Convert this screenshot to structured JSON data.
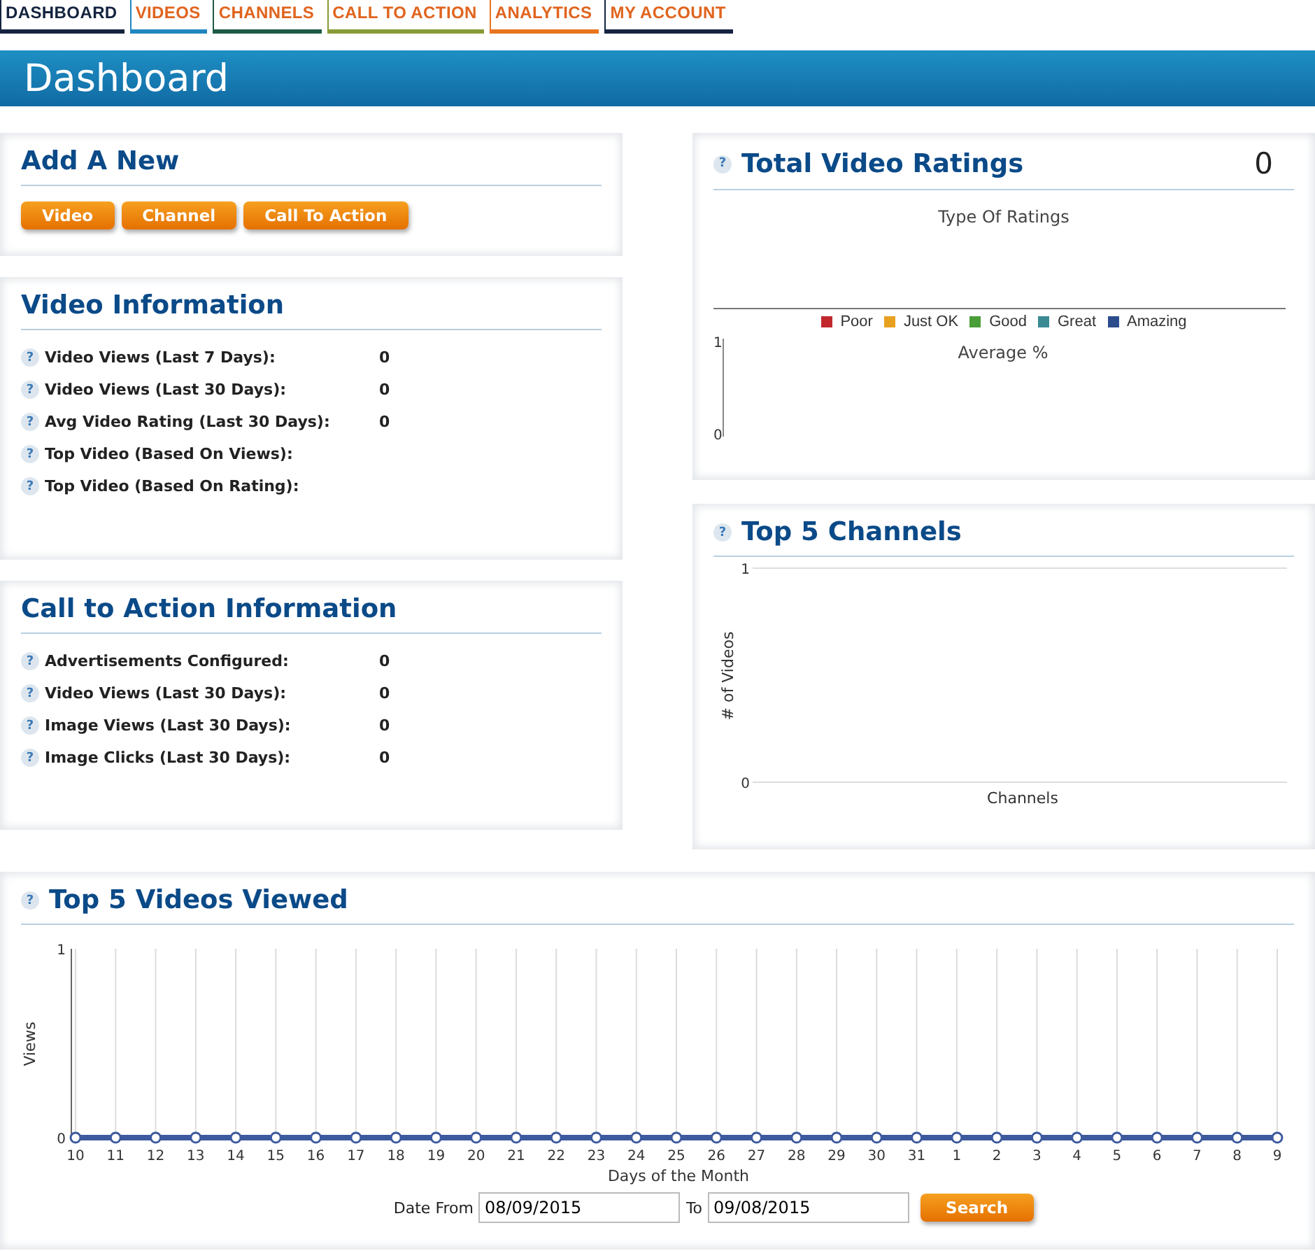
{
  "nav_tabs": [
    {
      "label": "DASHBOARD",
      "selected": true,
      "color": "#14233f"
    },
    {
      "label": "VIDEOS",
      "selected": false,
      "color": "#1f86bf"
    },
    {
      "label": "CHANNELS",
      "selected": false,
      "color": "#1d5b46"
    },
    {
      "label": "CALL TO ACTION",
      "selected": false,
      "color": "#879a36"
    },
    {
      "label": "ANALYTICS",
      "selected": false,
      "color": "#e8741e"
    },
    {
      "label": "MY ACCOUNT",
      "selected": false,
      "color": "#14233f"
    }
  ],
  "page_title": "Dashboard",
  "add_new": {
    "title": "Add A New",
    "buttons": [
      "Video",
      "Channel",
      "Call To Action"
    ]
  },
  "video_information": {
    "title": "Video Information",
    "rows": [
      {
        "help": "?",
        "label": "Video Views (Last 7 Days):",
        "value": "0"
      },
      {
        "help": "?",
        "label": "Video Views (Last 30 Days):",
        "value": "0"
      },
      {
        "help": "?",
        "label": "Avg Video Rating (Last 30 Days):",
        "value": "0"
      },
      {
        "help": "?",
        "label": "Top Video (Based On Views):"
      },
      {
        "help": "?",
        "label": "Top Video (Based On Rating):"
      }
    ]
  },
  "call_to_action_information": {
    "title": "Call to Action Information",
    "rows": [
      {
        "help": "?",
        "label": "Advertisements Configured:",
        "value": "0"
      },
      {
        "help": "?",
        "label": "Video Views (Last 30 Days):",
        "value": "0"
      },
      {
        "help": "?",
        "label": "Image Views (Last 30 Days):",
        "value": "0"
      },
      {
        "help": "?",
        "label": "Image Clicks (Last 30 Days):",
        "value": "0"
      }
    ]
  },
  "total_video_ratings": {
    "help": "?",
    "title": "Total Video Ratings",
    "total": "0",
    "type_chart_title": "Type Of Ratings",
    "legend": [
      {
        "label": "Poor",
        "color": "#c0282d"
      },
      {
        "label": "Just OK",
        "color": "#e8a020"
      },
      {
        "label": "Good",
        "color": "#4a9e38"
      },
      {
        "label": "Great",
        "color": "#3a8a94"
      },
      {
        "label": "Amazing",
        "color": "#2c4c8c"
      }
    ],
    "average_chart": {
      "title": "Average %",
      "y_ticks": [
        "1",
        "0"
      ]
    }
  },
  "top_5_channels": {
    "help": "?",
    "title": "Top 5 Channels",
    "y_ticks": [
      "1",
      "0"
    ],
    "y_axis_title": "# of Videos",
    "x_axis_title": "Channels"
  },
  "top_5_videos_viewed": {
    "help": "?",
    "title": "Top 5 Videos Viewed",
    "chart_data": {
      "type": "line",
      "xlabel": "Days of the Month",
      "ylabel": "Views",
      "grid": true,
      "categories": [
        "10",
        "11",
        "12",
        "13",
        "14",
        "15",
        "16",
        "17",
        "18",
        "19",
        "20",
        "21",
        "22",
        "23",
        "24",
        "25",
        "26",
        "27",
        "28",
        "29",
        "30",
        "31",
        "1",
        "2",
        "3",
        "4",
        "5",
        "6",
        "7",
        "8",
        "9"
      ],
      "yticks": [
        0,
        1
      ],
      "ylim": [
        0,
        1
      ],
      "series": [
        {
          "color": "#3d5a9e",
          "marker": true,
          "values": [
            0,
            0,
            0,
            0,
            0,
            0,
            0,
            0,
            0,
            0,
            0,
            0,
            0,
            0,
            0,
            0,
            0,
            0,
            0,
            0,
            0,
            0,
            0,
            0,
            0,
            0,
            0,
            0,
            0,
            0,
            0
          ]
        }
      ]
    },
    "date_from_label": "Date From",
    "date_from": "08/09/2015",
    "to_label": "To",
    "date_to": "09/08/2015",
    "search_button": "Search"
  }
}
